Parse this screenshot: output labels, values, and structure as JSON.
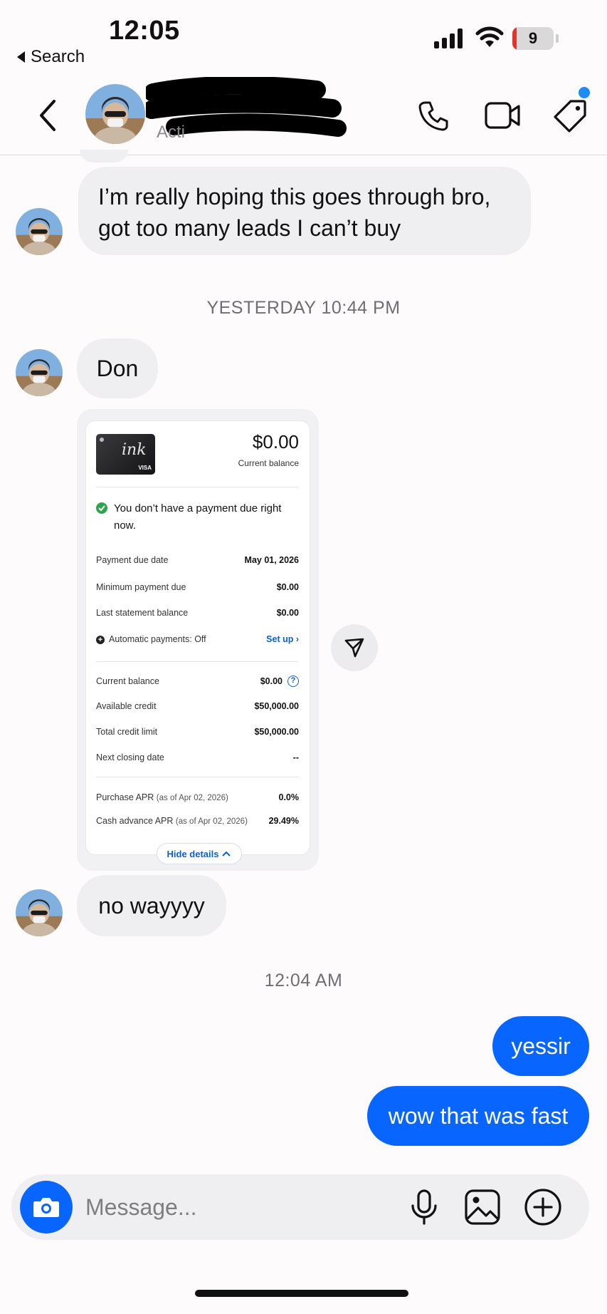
{
  "status_bar": {
    "time": "12:05",
    "back_label": "Search",
    "battery": "9",
    "battery_color": "#e0352c"
  },
  "header": {
    "subtitle_visible": "Acti      ",
    "icons": [
      "back-chevron-icon",
      "phone-icon",
      "video-camera-icon",
      "tag-icon"
    ],
    "notification_dot_color": "#1e8cf5"
  },
  "messages": {
    "first": "I’m really hoping this goes through bro, got too many leads I can’t buy",
    "ts1": "YESTERDAY 10:44 PM",
    "don": "Don",
    "no_way": "no wayyyy",
    "ts2": "12:04 AM",
    "yessir": "yessir",
    "fast": "wow that was fast"
  },
  "card": {
    "card_brand_text": "ink",
    "card_network": "VISA",
    "balance": "$0.00",
    "balance_caption": "Current balance",
    "note": "You don’t have a payment due right now.",
    "rows": [
      {
        "label": "Payment due date",
        "value": "May 01, 2026"
      },
      {
        "label": "Minimum payment due",
        "value": "$0.00"
      },
      {
        "label": "Last statement balance",
        "value": "$0.00"
      },
      {
        "label": "Automatic payments: Off",
        "value": "Set up"
      },
      {
        "label": "Current balance",
        "value": "$0.00"
      },
      {
        "label": "Available credit",
        "value": "$50,000.00"
      },
      {
        "label": "Total credit limit",
        "value": "$50,000.00"
      },
      {
        "label": "Next closing date",
        "value": "--"
      },
      {
        "label": "Purchase APR",
        "label_suffix": "(as of Apr 02, 2026)",
        "value": "0.0%"
      },
      {
        "label": "Cash advance APR",
        "label_suffix": "(as of Apr 02, 2026)",
        "value": "29.49%"
      }
    ],
    "hide_details": "Hide details",
    "accent": "#0b5fd6"
  },
  "composer": {
    "placeholder": "Message...",
    "accent": "#0866ff"
  }
}
